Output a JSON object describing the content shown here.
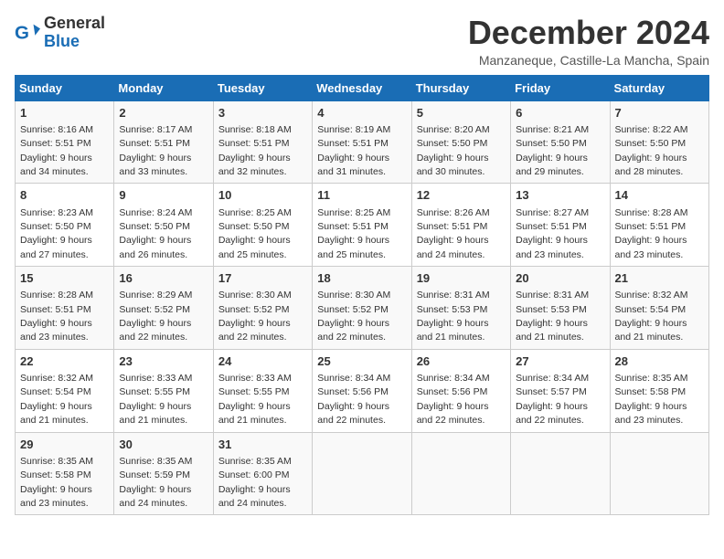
{
  "logo": {
    "general": "General",
    "blue": "Blue"
  },
  "title": "December 2024",
  "location": "Manzaneque, Castille-La Mancha, Spain",
  "weekdays": [
    "Sunday",
    "Monday",
    "Tuesday",
    "Wednesday",
    "Thursday",
    "Friday",
    "Saturday"
  ],
  "weeks": [
    [
      {
        "day": "1",
        "sunrise": "8:16 AM",
        "sunset": "5:51 PM",
        "daylight": "9 hours and 34 minutes."
      },
      {
        "day": "2",
        "sunrise": "8:17 AM",
        "sunset": "5:51 PM",
        "daylight": "9 hours and 33 minutes."
      },
      {
        "day": "3",
        "sunrise": "8:18 AM",
        "sunset": "5:51 PM",
        "daylight": "9 hours and 32 minutes."
      },
      {
        "day": "4",
        "sunrise": "8:19 AM",
        "sunset": "5:51 PM",
        "daylight": "9 hours and 31 minutes."
      },
      {
        "day": "5",
        "sunrise": "8:20 AM",
        "sunset": "5:50 PM",
        "daylight": "9 hours and 30 minutes."
      },
      {
        "day": "6",
        "sunrise": "8:21 AM",
        "sunset": "5:50 PM",
        "daylight": "9 hours and 29 minutes."
      },
      {
        "day": "7",
        "sunrise": "8:22 AM",
        "sunset": "5:50 PM",
        "daylight": "9 hours and 28 minutes."
      }
    ],
    [
      {
        "day": "8",
        "sunrise": "8:23 AM",
        "sunset": "5:50 PM",
        "daylight": "9 hours and 27 minutes."
      },
      {
        "day": "9",
        "sunrise": "8:24 AM",
        "sunset": "5:50 PM",
        "daylight": "9 hours and 26 minutes."
      },
      {
        "day": "10",
        "sunrise": "8:25 AM",
        "sunset": "5:50 PM",
        "daylight": "9 hours and 25 minutes."
      },
      {
        "day": "11",
        "sunrise": "8:25 AM",
        "sunset": "5:51 PM",
        "daylight": "9 hours and 25 minutes."
      },
      {
        "day": "12",
        "sunrise": "8:26 AM",
        "sunset": "5:51 PM",
        "daylight": "9 hours and 24 minutes."
      },
      {
        "day": "13",
        "sunrise": "8:27 AM",
        "sunset": "5:51 PM",
        "daylight": "9 hours and 23 minutes."
      },
      {
        "day": "14",
        "sunrise": "8:28 AM",
        "sunset": "5:51 PM",
        "daylight": "9 hours and 23 minutes."
      }
    ],
    [
      {
        "day": "15",
        "sunrise": "8:28 AM",
        "sunset": "5:51 PM",
        "daylight": "9 hours and 23 minutes."
      },
      {
        "day": "16",
        "sunrise": "8:29 AM",
        "sunset": "5:52 PM",
        "daylight": "9 hours and 22 minutes."
      },
      {
        "day": "17",
        "sunrise": "8:30 AM",
        "sunset": "5:52 PM",
        "daylight": "9 hours and 22 minutes."
      },
      {
        "day": "18",
        "sunrise": "8:30 AM",
        "sunset": "5:52 PM",
        "daylight": "9 hours and 22 minutes."
      },
      {
        "day": "19",
        "sunrise": "8:31 AM",
        "sunset": "5:53 PM",
        "daylight": "9 hours and 21 minutes."
      },
      {
        "day": "20",
        "sunrise": "8:31 AM",
        "sunset": "5:53 PM",
        "daylight": "9 hours and 21 minutes."
      },
      {
        "day": "21",
        "sunrise": "8:32 AM",
        "sunset": "5:54 PM",
        "daylight": "9 hours and 21 minutes."
      }
    ],
    [
      {
        "day": "22",
        "sunrise": "8:32 AM",
        "sunset": "5:54 PM",
        "daylight": "9 hours and 21 minutes."
      },
      {
        "day": "23",
        "sunrise": "8:33 AM",
        "sunset": "5:55 PM",
        "daylight": "9 hours and 21 minutes."
      },
      {
        "day": "24",
        "sunrise": "8:33 AM",
        "sunset": "5:55 PM",
        "daylight": "9 hours and 21 minutes."
      },
      {
        "day": "25",
        "sunrise": "8:34 AM",
        "sunset": "5:56 PM",
        "daylight": "9 hours and 22 minutes."
      },
      {
        "day": "26",
        "sunrise": "8:34 AM",
        "sunset": "5:56 PM",
        "daylight": "9 hours and 22 minutes."
      },
      {
        "day": "27",
        "sunrise": "8:34 AM",
        "sunset": "5:57 PM",
        "daylight": "9 hours and 22 minutes."
      },
      {
        "day": "28",
        "sunrise": "8:35 AM",
        "sunset": "5:58 PM",
        "daylight": "9 hours and 23 minutes."
      }
    ],
    [
      {
        "day": "29",
        "sunrise": "8:35 AM",
        "sunset": "5:58 PM",
        "daylight": "9 hours and 23 minutes."
      },
      {
        "day": "30",
        "sunrise": "8:35 AM",
        "sunset": "5:59 PM",
        "daylight": "9 hours and 24 minutes."
      },
      {
        "day": "31",
        "sunrise": "8:35 AM",
        "sunset": "6:00 PM",
        "daylight": "9 hours and 24 minutes."
      },
      null,
      null,
      null,
      null
    ]
  ]
}
